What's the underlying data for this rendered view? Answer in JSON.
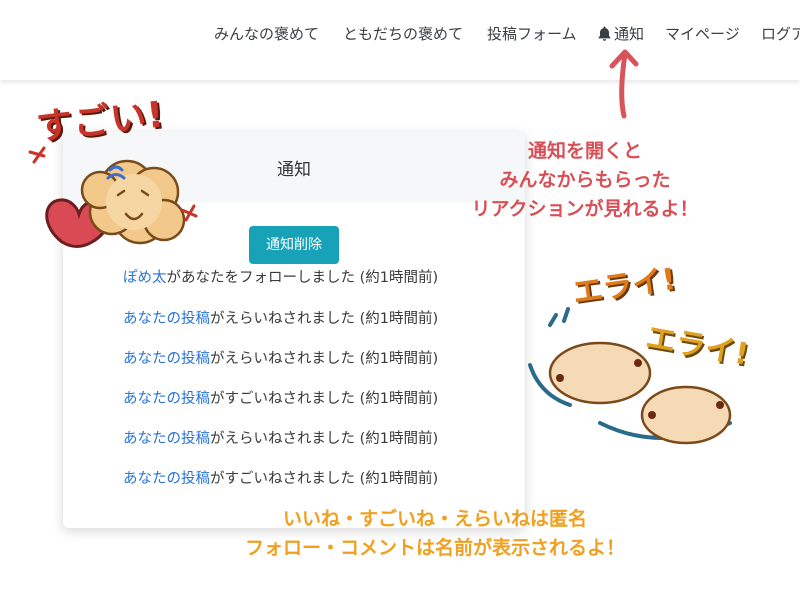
{
  "nav": {
    "items": [
      {
        "label": "みんなの褒めて"
      },
      {
        "label": "ともだちの褒めて"
      },
      {
        "label": "投稿フォーム"
      },
      {
        "label": "通知",
        "icon": "bell-icon"
      },
      {
        "label": "マイページ"
      },
      {
        "label": "ログア"
      }
    ]
  },
  "card": {
    "title": "通知",
    "delete_label": "通知削除",
    "notifications": [
      {
        "link": "ぽめ太",
        "text": "があなたをフォローしました (約1時間前)"
      },
      {
        "link": "あなたの投稿",
        "text": "がえらいねされました (約1時間前)"
      },
      {
        "link": "あなたの投稿",
        "text": "がえらいねされました (約1時間前)"
      },
      {
        "link": "あなたの投稿",
        "text": "がすごいねされました (約1時間前)"
      },
      {
        "link": "あなたの投稿",
        "text": "がえらいねされました (約1時間前)"
      },
      {
        "link": "あなたの投稿",
        "text": "がすごいねされました (約1時間前)"
      }
    ]
  },
  "annotations": {
    "top": [
      "通知を開くと",
      "みんなからもらった",
      "リアクションが見れるよ！"
    ],
    "bottom": [
      "いいね・すごいね・えらいねは匿名",
      "フォロー・コメントは名前が表示されるよ！"
    ]
  },
  "stickers": {
    "sugoi": "すごい!",
    "erai": [
      "エライ!",
      "エライ!"
    ]
  },
  "colors": {
    "accent_button": "#17a2b8",
    "link": "#2a74d8",
    "annotation_red": "#d84f55",
    "annotation_orange": "#f0a020",
    "sticker_red": "#c8342a",
    "sticker_orange": "#e07b1a"
  }
}
